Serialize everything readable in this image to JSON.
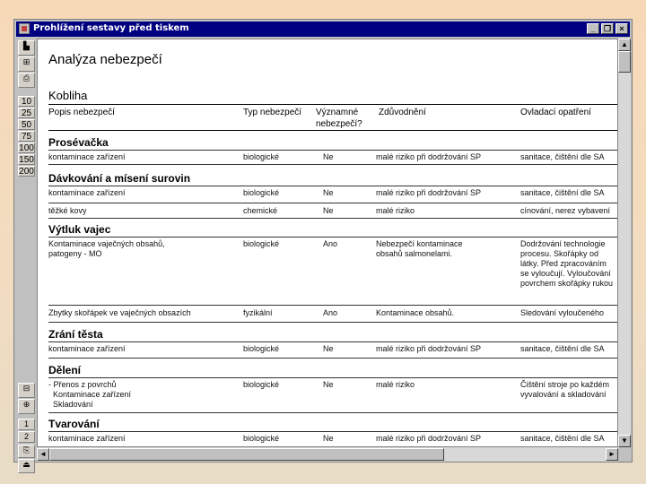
{
  "window": {
    "title": "Prohlížení sestavy před tiskem",
    "controls": {
      "minimize": "_",
      "restore": "❐",
      "close": "×"
    }
  },
  "toolbar": {
    "zoom_levels": [
      "10",
      "25",
      "50",
      "75",
      "100",
      "150",
      "200"
    ],
    "pages": [
      "1",
      "2"
    ]
  },
  "report": {
    "title": "Analýza nebezpečí",
    "product": "Kobliha",
    "columns": {
      "hazard": "Popis nebezpečí",
      "type": "Typ nebezpečí",
      "significant_l1": "Významné",
      "significant_l2": "nebezpečí?",
      "justification": "Zdůvodnění",
      "control": "Ovladací opatření"
    },
    "sections": [
      {
        "title": "Prosévačka",
        "rows": [
          {
            "hazard": "kontaminace zařízení",
            "type": "biologické",
            "sig": "Ne",
            "just": "malé riziko při dodržování SP",
            "ctrl": "sanitace, čištění dle SA"
          }
        ]
      },
      {
        "title": "Dávkování a mísení surovin",
        "rows": [
          {
            "hazard": "kontaminace zařízení",
            "type": "biologické",
            "sig": "Ne",
            "just": "malé riziko při dodržování SP",
            "ctrl": "sanitace, čištění dle SA"
          },
          {
            "hazard": "těžké kovy",
            "type": "chemické",
            "sig": "Ne",
            "just": "malé riziko",
            "ctrl": "cínování, nerez vybavení"
          }
        ]
      },
      {
        "title": "Výtluk vajec",
        "rows": [
          {
            "hazard": "Kontaminace vaječných obsahů,",
            "hazard2": "patogeny - MO",
            "type": "biologické",
            "sig": "Ano",
            "just": "Nebezpečí kontaminace",
            "just2": "obsahů salmonelami.",
            "ctrl": "Dodržování technologie",
            "ctrl2": "procesu. Skořápky od",
            "ctrl3": "látky. Před zpracováním",
            "ctrl4": "se vyloučují. Vyloučování",
            "ctrl5": "povrchem skořápky rukou"
          },
          {
            "hazard": "Zbytky skořápek ve vaječných obsazích",
            "type": "fyzikální",
            "sig": "Ano",
            "just": "Kontaminace obsahů.",
            "ctrl": "Sledování vyloučeného"
          }
        ]
      },
      {
        "title": "Zrání těsta",
        "rows": [
          {
            "hazard": "kontaminace zařízení",
            "type": "biologické",
            "sig": "Ne",
            "just": "malé riziko při dodržování SP",
            "ctrl": "sanitace, čištění dle SA"
          }
        ]
      },
      {
        "title": "Dělení",
        "rows": [
          {
            "hazard": "- Přenos z povrchů",
            "hazard2": "  Kontaminace zařízení",
            "hazard3": "  Skladování",
            "type": "biologické",
            "sig": "Ne",
            "just": "malé riziko",
            "ctrl": "Čištění stroje po každém",
            "ctrl2": "vyvalování a skladování"
          }
        ]
      },
      {
        "title": "Tvarování",
        "rows": [
          {
            "hazard": "kontaminace zařízení",
            "type": "biologické",
            "sig": "Ne",
            "just": "malé riziko při dodržování SP",
            "ctrl": "sanitace, čištění dle SA"
          }
        ]
      }
    ]
  }
}
